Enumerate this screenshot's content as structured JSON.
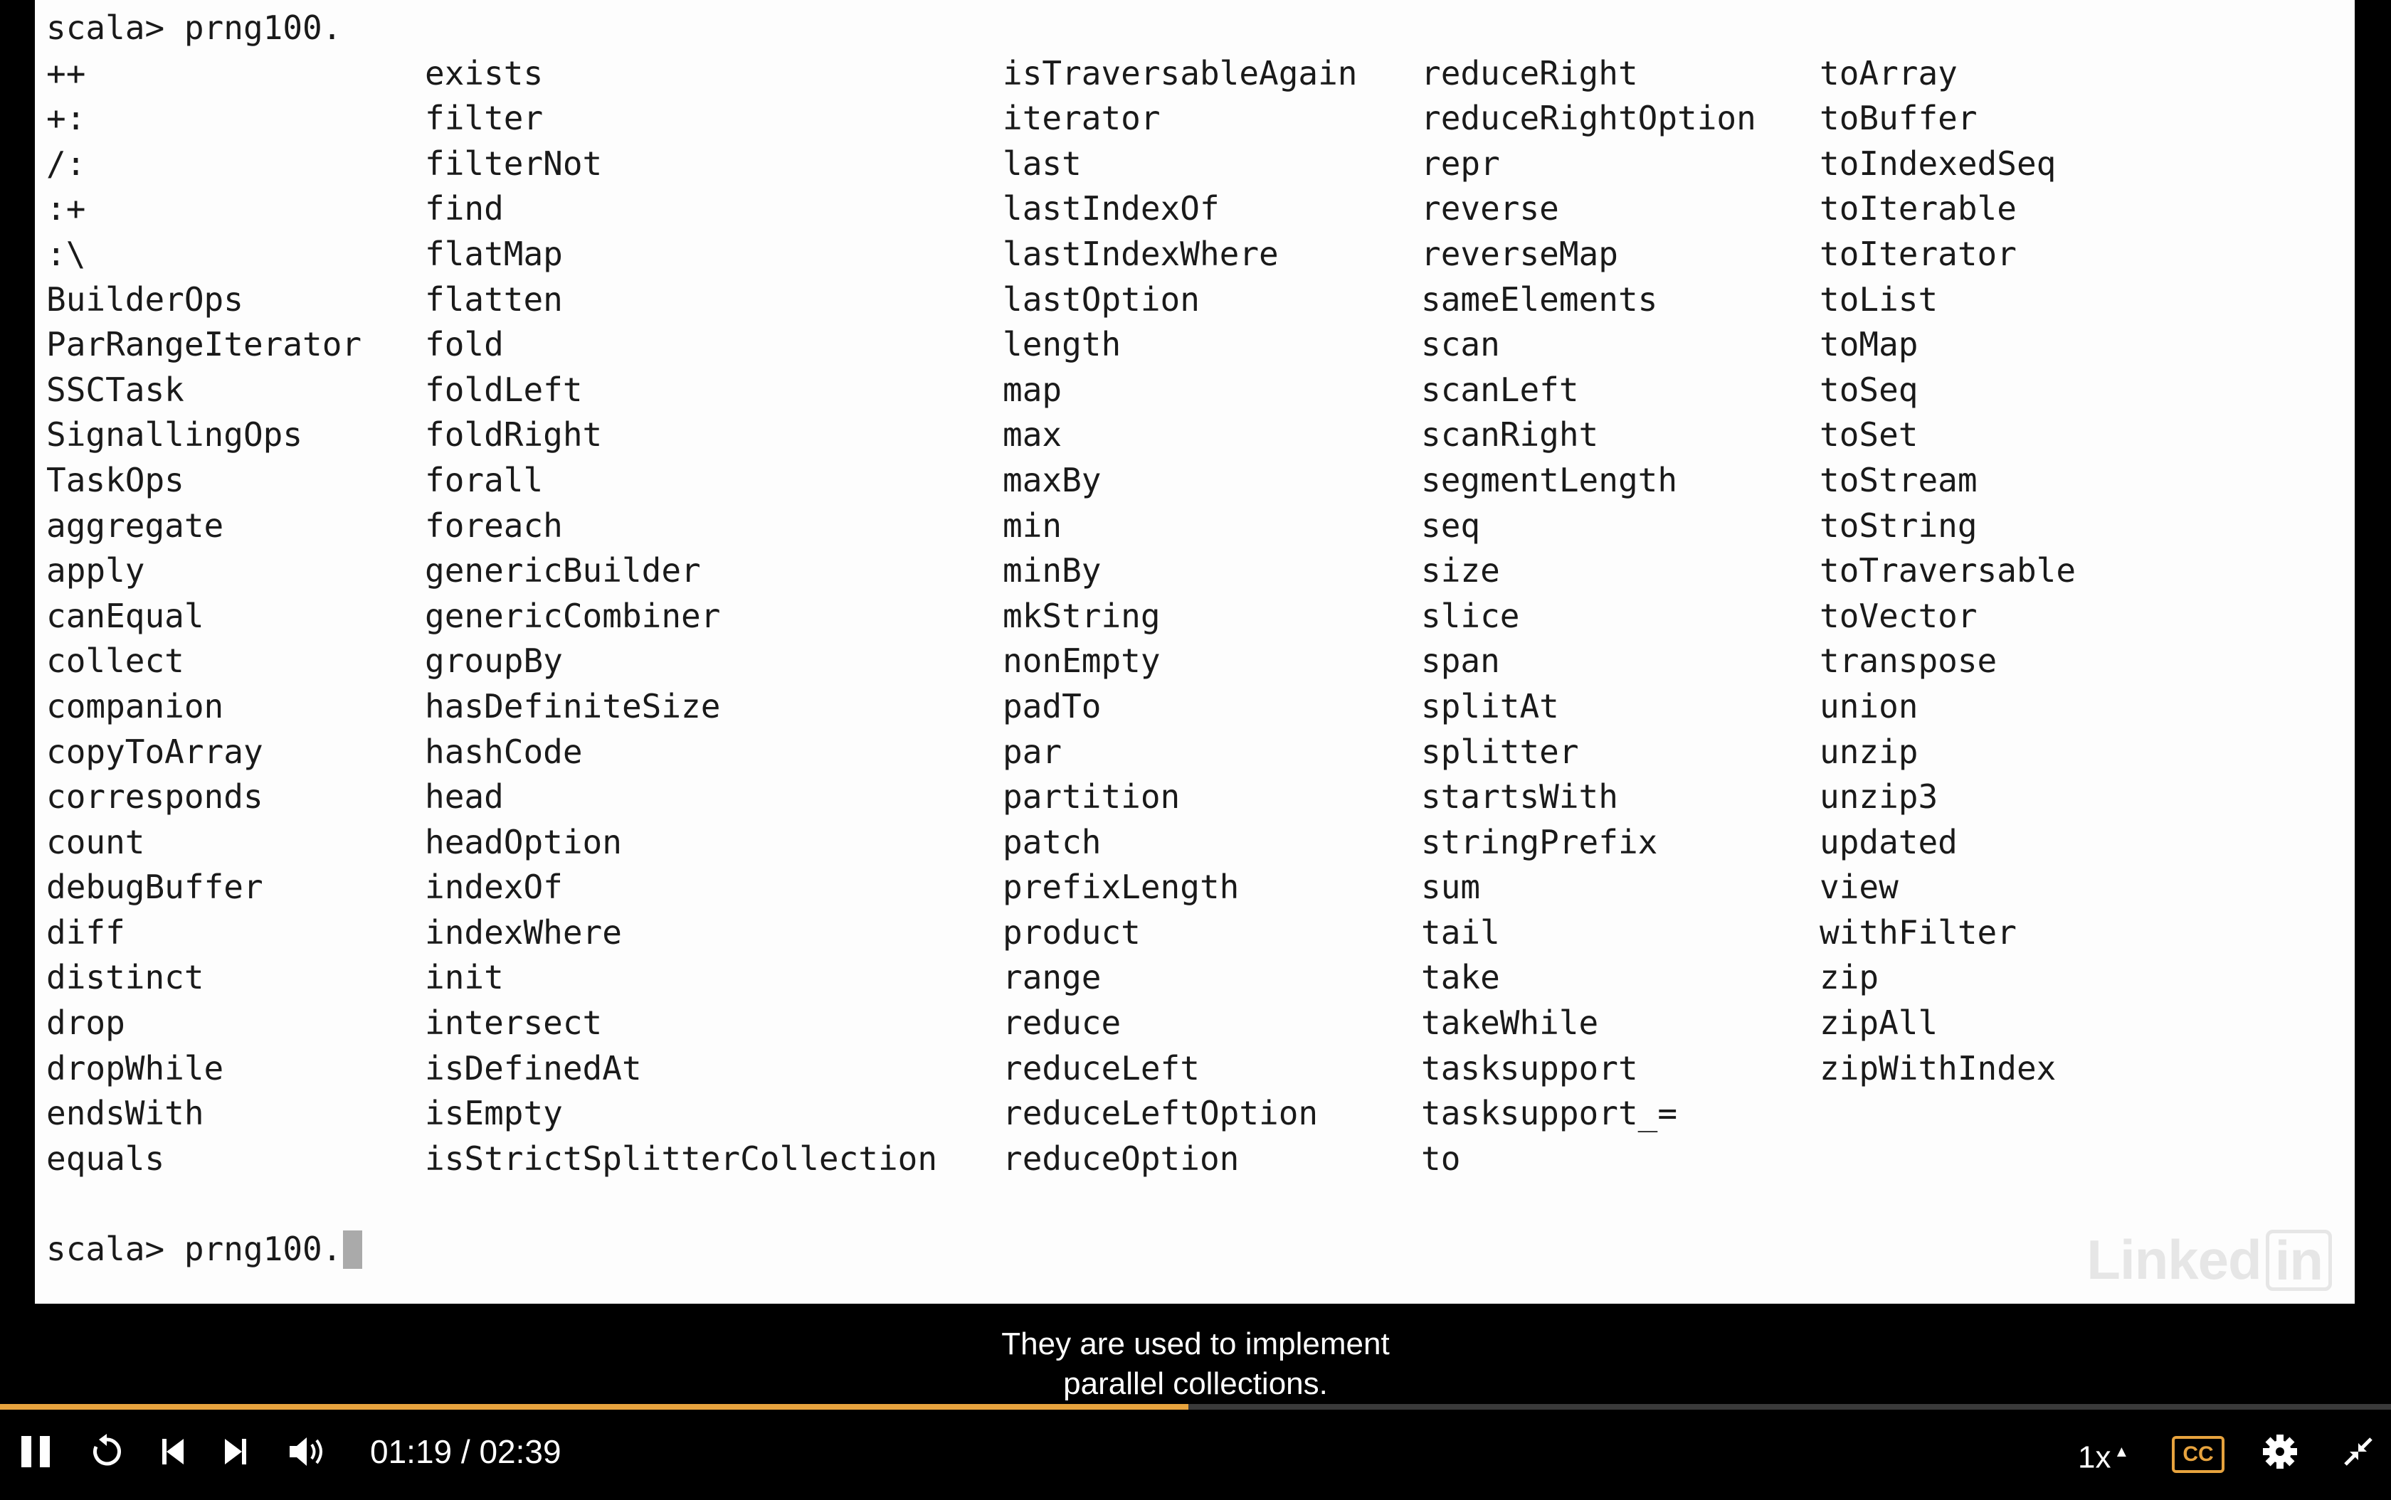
{
  "terminal": {
    "prompt_top": "scala> prng100.",
    "prompt_bottom": "scala> prng100.",
    "columns": [
      [
        "++",
        "+:",
        "/:",
        ":+",
        ":\\",
        "BuilderOps",
        "ParRangeIterator",
        "SSCTask",
        "SignallingOps",
        "TaskOps",
        "aggregate",
        "apply",
        "canEqual",
        "collect",
        "companion",
        "copyToArray",
        "corresponds",
        "count",
        "debugBuffer",
        "diff",
        "distinct",
        "drop",
        "dropWhile",
        "endsWith",
        "equals"
      ],
      [
        "exists",
        "filter",
        "filterNot",
        "find",
        "flatMap",
        "flatten",
        "fold",
        "foldLeft",
        "foldRight",
        "forall",
        "foreach",
        "genericBuilder",
        "genericCombiner",
        "groupBy",
        "hasDefiniteSize",
        "hashCode",
        "head",
        "headOption",
        "indexOf",
        "indexWhere",
        "init",
        "intersect",
        "isDefinedAt",
        "isEmpty",
        "isStrictSplitterCollection"
      ],
      [
        "isTraversableAgain",
        "iterator",
        "last",
        "lastIndexOf",
        "lastIndexWhere",
        "lastOption",
        "length",
        "map",
        "max",
        "maxBy",
        "min",
        "minBy",
        "mkString",
        "nonEmpty",
        "padTo",
        "par",
        "partition",
        "patch",
        "prefixLength",
        "product",
        "range",
        "reduce",
        "reduceLeft",
        "reduceLeftOption",
        "reduceOption"
      ],
      [
        "reduceRight",
        "reduceRightOption",
        "repr",
        "reverse",
        "reverseMap",
        "sameElements",
        "scan",
        "scanLeft",
        "scanRight",
        "segmentLength",
        "seq",
        "size",
        "slice",
        "span",
        "splitAt",
        "splitter",
        "startsWith",
        "stringPrefix",
        "sum",
        "tail",
        "take",
        "takeWhile",
        "tasksupport",
        "tasksupport_=",
        "to"
      ],
      [
        "toArray",
        "toBuffer",
        "toIndexedSeq",
        "toIterable",
        "toIterator",
        "toList",
        "toMap",
        "toSeq",
        "toSet",
        "toStream",
        "toString",
        "toTraversable",
        "toVector",
        "transpose",
        "union",
        "unzip",
        "unzip3",
        "updated",
        "view",
        "withFilter",
        "zip",
        "zipAll",
        "zipWithIndex"
      ]
    ]
  },
  "watermark": {
    "text": "Linked",
    "box_text": "in"
  },
  "caption": {
    "line1": "They are used to implement",
    "line2": "parallel collections."
  },
  "player": {
    "time": "01:19 / 02:39",
    "progress": 0.497,
    "speed": "1x",
    "speed_caret": "▲",
    "cc_label": "CC",
    "icons": [
      "pause-icon",
      "replay-icon",
      "previous-icon",
      "next-icon",
      "volume-icon",
      "gear-icon",
      "exit-fullscreen-icon"
    ],
    "accent_color": "#e7a33e"
  }
}
